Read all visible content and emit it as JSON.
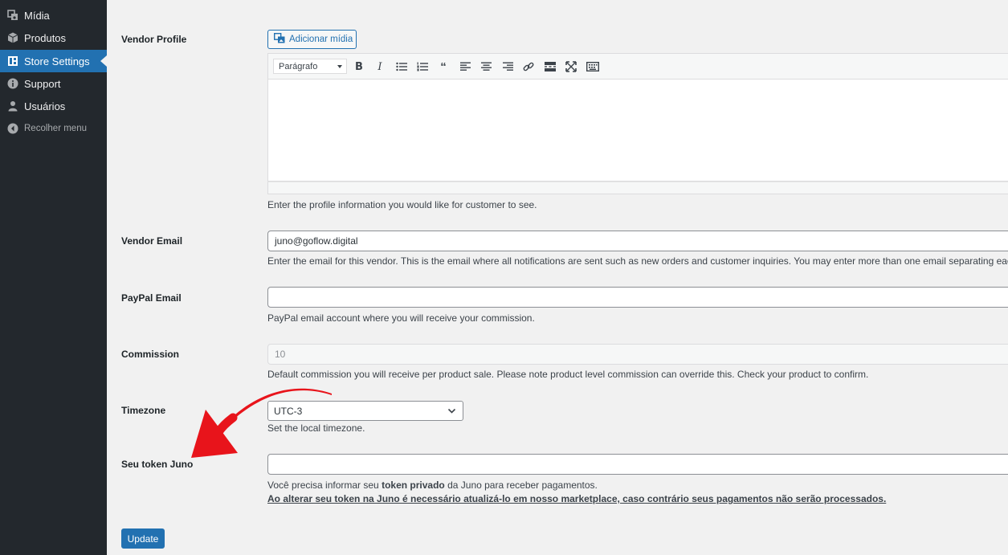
{
  "sidebar": {
    "items": [
      {
        "label": "Mídia",
        "icon": "media-icon",
        "active": false
      },
      {
        "label": "Produtos",
        "icon": "products-icon",
        "active": false
      },
      {
        "label": "Store Settings",
        "icon": "store-settings-icon",
        "active": true
      },
      {
        "label": "Support",
        "icon": "info-icon",
        "active": false
      },
      {
        "label": "Usuários",
        "icon": "users-icon",
        "active": false
      }
    ],
    "collapse_label": "Recolher menu"
  },
  "vendor_profile": {
    "label": "Vendor Profile",
    "add_media_label": "Adicionar mídia",
    "format_select": "Parágrafo",
    "description": "Enter the profile information you would like for customer to see."
  },
  "vendor_email": {
    "label": "Vendor Email",
    "value": "juno@goflow.digital",
    "description": "Enter the email for this vendor. This is the email where all notifications are sent such as new orders and customer inquiries. You may enter more than one email separating eac"
  },
  "paypal_email": {
    "label": "PayPal Email",
    "value": "",
    "description": "PayPal email account where you will receive your commission."
  },
  "commission": {
    "label": "Commission",
    "value": "10",
    "description": "Default commission you will receive per product sale. Please note product level commission can override this. Check your product to confirm."
  },
  "timezone": {
    "label": "Timezone",
    "value": "UTC-3",
    "description": "Set the local timezone."
  },
  "juno_token": {
    "label": "Seu token Juno",
    "value": "",
    "desc_prefix": "Você precisa informar seu ",
    "desc_bold": "token privado",
    "desc_suffix": " da Juno para receber pagamentos.",
    "warning": "Ao alterar seu token na Juno é necessário atualizá-lo em nosso marketplace, caso contrário seus pagamentos não serão processados."
  },
  "update_label": "Update",
  "colors": {
    "accent": "#2271b1",
    "sidebar": "#23282d",
    "arrow": "#e8141b"
  }
}
